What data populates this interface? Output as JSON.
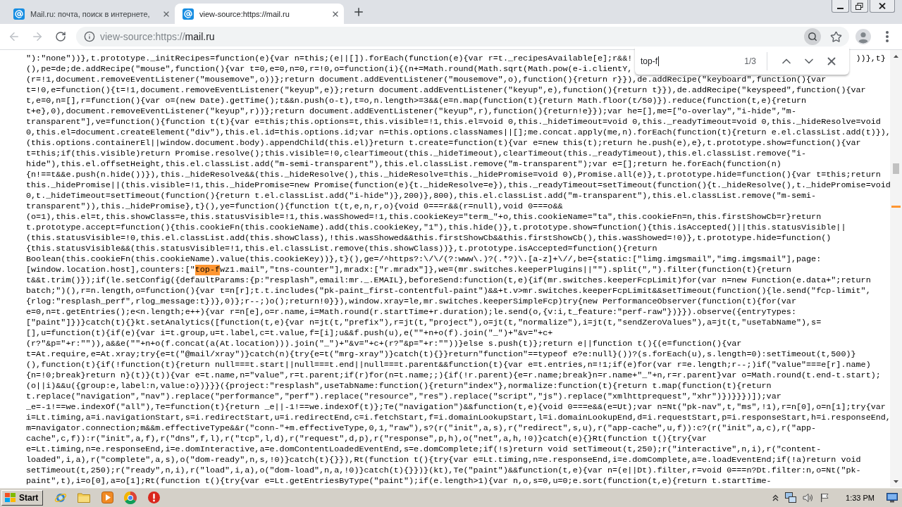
{
  "tabs": [
    {
      "title": "Mail.ru: почта, поиск в интернете,",
      "selected": false
    },
    {
      "title": "view-source:https://mail.ru",
      "selected": true
    }
  ],
  "toolbar": {
    "back_disabled": true,
    "forward_disabled": true,
    "address": {
      "prefix": "view-source:https://",
      "host": "mail.ru"
    }
  },
  "find_bar": {
    "query": "top-f",
    "count": "1/3"
  },
  "source": {
    "lines": [
      {
        "parts": [
          {
            "text": "\"):\"none\"))},t.prototype._initRecipes=function(e){var n=this;(e||[]).forEach(function(e){var r=t._recipesAvailable[e];r&&!",
            "highlighted": false
          }
        ],
        "tail": "))},t}"
      },
      {
        "parts": [
          {
            "text": "(),pe=de;de.addRecipe(\"mouse\",function(){var t=0,e=0,n=0,r=!0,o=function(i){(n+=Math.round(Math.sqrt(Math.pow(e-i.clientY,",
            "highlighted": false
          }
        ]
      },
      {
        "parts": [
          {
            "text": "(r=!1,document.removeEventListener(\"mousemove\",o))};return document.addEventListener(\"mousemove\",o),function(){return r}}),de.addRecipe(\"keyboard\",function(){var",
            "highlighted": false
          }
        ]
      },
      {
        "parts": [
          {
            "text": "t=!0,e=function(){t=!1,document.removeEventListener(\"keyup\",e)};return document.addEventListener(\"keyup\",e),function(){return t}}),de.addRecipe(\"keyspeed\",function(){var",
            "highlighted": false
          }
        ]
      },
      {
        "parts": [
          {
            "text": "t,e=0,n=[],r=function(){var o=(new Date).getTime();t&&n.push(o-t),t=o,n.length>=3&&(e=n.map(function(t){return Math.floor(t/50)}).reduce(function(t,e){return",
            "highlighted": false
          }
        ]
      },
      {
        "parts": [
          {
            "text": "t+e},0),document.removeEventListener(\"keyup\",r))};return document.addEventListener(\"keyup\",r),function(){return!e}});var he=[],me=[\"o-overlay\",\"i-hide\",\"m-",
            "highlighted": false
          }
        ]
      },
      {
        "parts": [
          {
            "text": "transparent\"],ve=function(){function t(t){var e=this;this.options=t,this.visible=!1,this.el=void 0,this._hideTimeout=void 0,this._readyTimeout=void 0,this._hideResolve=void",
            "highlighted": false
          }
        ]
      },
      {
        "parts": [
          {
            "text": "0,this.el=document.createElement(\"div\"),this.el.id=this.options.id;var n=this.options.classNames||[];me.concat.apply(me,n).forEach(function(t){return e.el.classList.add(t)}),",
            "highlighted": false
          }
        ]
      },
      {
        "parts": [
          {
            "text": "(this.options.containerEl||window.document.body).appendChild(this.el)}return t.create=function(t){var e=new this(t);return he.push(e),e},t.prototype.show=function(){var",
            "highlighted": false
          }
        ]
      },
      {
        "parts": [
          {
            "text": "t=this;if(this.visible)return Promise.resolve();this.visible=!0,clearTimeout(this._hideTimeout),clearTimeout(this._readyTimeout),this.el.classList.remove(\"i-",
            "highlighted": false
          }
        ]
      },
      {
        "parts": [
          {
            "text": "hide\"),this.el.offsetHeight,this.el.classList.add(\"m-semi-transparent\"),this.el.classList.remove(\"m-transparent\");var e=[];return he.forEach(function(n)",
            "highlighted": false
          }
        ]
      },
      {
        "parts": [
          {
            "text": "{n!==t&&e.push(n.hide())}),this._hideResolve&&(this._hideResolve(),this._hideResolve=this._hidePromise=void 0),Promise.all(e)},t.prototype.hide=function(){var t=this;return",
            "highlighted": false
          }
        ]
      },
      {
        "parts": [
          {
            "text": "this._hidePromise||(this.visible=!1,this._hidePromise=new Promise(function(e){t._hideResolve=e}),this._readyTimeout=setTimeout(function(){t._hideResolve(),t._hidePromise=void",
            "highlighted": false
          }
        ]
      },
      {
        "parts": [
          {
            "text": "0,t._hideTimeout=setTimeout(function(){return t.el.classList.add(\"i-hide\")},200)},800),this.el.classList.add(\"m-transparent\"),this.el.classList.remove(\"m-semi-",
            "highlighted": false
          }
        ]
      },
      {
        "parts": [
          {
            "text": "transparent\")),this._hidePromise},t}(),ye=function(){function t(t,e,n,r,o){void 0===r&&(r=null),void 0===o&&",
            "highlighted": false
          }
        ]
      },
      {
        "parts": [
          {
            "text": "(o=1),this.el=t,this.showClass=e,this.statusVisible=!1,this.wasShowed=!1,this.cookieKey=\"term_\"+o,this.cookieName=\"ta\",this.cookieFn=n,this.firstShowCb=r}return",
            "highlighted": false
          }
        ]
      },
      {
        "parts": [
          {
            "text": "t.prototype.accept=function(){this.cookieFn(this.cookieName).add(this.cookieKey,\"1\"),this.hide()},t.prototype.show=function(){this.isAccepted()||this.statusVisible||",
            "highlighted": false
          }
        ]
      },
      {
        "parts": [
          {
            "text": "(this.statusVisible=!0,this.el.classList.add(this.showClass),!this.wasShowed&&this.firstShowCb&&this.firstShowCb(),this.wasShowed=!0)},t.prototype.hide=function()",
            "highlighted": false
          }
        ]
      },
      {
        "parts": [
          {
            "text": "{this.statusVisible&&(this.statusVisible=!1,this.el.classList.remove(this.showClass))},t.prototype.isAccepted=function(){return",
            "highlighted": false
          }
        ]
      },
      {
        "parts": [
          {
            "text": "Boolean(this.cookieFn(this.cookieName).value(this.cookieKey))},t}(),ge=/^https?:\\/\\/(?:www\\.)?(.*?)\\.[a-z]+\\//,be={static:[\"limg.imgsmail\",\"img.imgsmail\"],page:",
            "highlighted": false
          }
        ]
      },
      {
        "parts": [
          {
            "text": "[window.location.host],counters:[\"",
            "highlighted": false
          },
          {
            "text": "top-f",
            "highlighted": true
          },
          {
            "text": "wz1.mail\",\"tns-counter\"],mradx:[\"r.mradx\"]},we=(mr.switches.keeperPlugins||\"\").split(\",\").filter(function(t){return",
            "highlighted": false
          }
        ]
      },
      {
        "parts": [
          {
            "text": "t&&t.trim()});if(le.setConfig({defaultParams:{p:\"resplash\",email:mr._.EMAIL},beforeSend:function(t,e){if(mr.switches.keeperFcpLimit)for(var n=new Function(e.data+\";return",
            "highlighted": false
          }
        ]
      },
      {
        "parts": [
          {
            "text": "batch;\")(),r=n.length,o=function(){var t=n[r];t.t.includes(\"pk-paint_first-contentful-paint\")&&+t.v>mr.switches.keeperFcpLimit&&setTimeout(function(){le.send(\"fcp-limit\",",
            "highlighted": false
          }
        ]
      },
      {
        "parts": [
          {
            "text": "{rlog:\"resplash_perf\",rlog_message:t})},0)};r--;)o();return!0}}),window.xray=le,mr.switches.keeperSimpleFcp)try{new PerformanceObserver(function(t){for(var",
            "highlighted": false
          }
        ]
      },
      {
        "parts": [
          {
            "text": "e=0,n=t.getEntries();e<n.length;e++){var r=n[e],o=r.name,i=Math.round(r.startTime+r.duration);le.send(o,{v:i,t_feature:\"perf-raw\"})}}).observe({entryTypes:",
            "highlighted": false
          }
        ]
      },
      {
        "parts": [
          {
            "text": "[\"paint\"]})}catch(t){}kt.setAnalytics([function(t,e){var n=jt(t,\"prefix\"),r=jt(t,\"project\"),o=jt(t,\"normalize\"),i=jt(t,\"sendZeroValues\"),a=jt(t,\"useTabName\"),s=",
            "highlighted": false
          }
        ]
      },
      {
        "parts": [
          {
            "text": "[],u=function(t){if(e){var i=t.group,u=t.label,c=t.value,f=[i];u&&f.push(u),e(\"\"+n+o(f).join(\"_\")+\"&v=\"+c+",
            "highlighted": false
          }
        ]
      },
      {
        "parts": [
          {
            "text": "(r?\"&p=\"+r:\"\")),a&&e(\"\"+n+o(f.concat(a(At.location))).join(\"_\")+\"&v=\"+c+(r?\"&p=\"+r:\"\"))}else s.push(t)};return e||function t(){(e=function(){var",
            "highlighted": false
          }
        ]
      },
      {
        "parts": [
          {
            "text": "t=At.require,e=At.xray;try{e=t(\"@mail/xray\")}catch(n){try{e=t(\"mrg-xray\")}catch(t){}}return\"function\"==typeof e?e:null}())?(s.forEach(u),s.length=0):setTimeout(t,500)}",
            "highlighted": false
          }
        ]
      },
      {
        "parts": [
          {
            "text": "(),function(t){if(!function(t){return null===t.start||null===t.end||null===t.parent&&function(t){var e=t.entries,n=!1;if(e)for(var r=e.length;r--;)if(\"value\"===e[r].name)",
            "highlighted": false
          }
        ]
      },
      {
        "parts": [
          {
            "text": "{n=!0;break}return n}(t)}(t)){var e=t.name,n=\"value\",r=t.parent;if(r)for(n=t.name;;){if(!r.parent){e=r.name;break}n=r.name+\"_\"+n,r=r.parent}var o=Math.round(t.end-t.start);",
            "highlighted": false
          }
        ]
      },
      {
        "parts": [
          {
            "text": "(o||i)&&u({group:e,label:n,value:o})}}}({project:\"resplash\",useTabName:function(){return\"index\"},normalize:function(t){return t.map(function(t){return",
            "highlighted": false
          }
        ]
      },
      {
        "parts": [
          {
            "text": "t.replace(\"navigation\",\"nav\").replace(\"performance\",\"perf\").replace(\"resource\",\"res\").replace(\"script\",\"js\").replace(\"xmlhttprequest\",\"xhr\")})}}})]);var",
            "highlighted": false
          }
        ]
      },
      {
        "parts": [
          {
            "text": "_e=-1!==we.indexOf(\"all\"),Te=function(t){return _e||-1!==we.indexOf(t)};Te(\"navigation\")&&function(t,e){void 0===e&&(e=Ut);var n=Nt(\"pk-nav\",t,\"ms\",!1),r=n[0],o=n[1];try{var",
            "highlighted": false
          }
        ]
      },
      {
        "parts": [
          {
            "text": "i=Lt.timing,a=i.navigationStart,s=i.redirectStart,u=i.redirectEnd,c=i.fetchStart,f=i.domainLookupStart,l=i.domainLookupEnd,d=i.requestStart,p=i.responseStart,h=i.responseEnd,",
            "highlighted": false
          }
        ]
      },
      {
        "parts": [
          {
            "text": "m=navigator.connection;m&&m.effectiveType&&r(\"conn-\"+m.effectiveType,0,1,\"raw\"),s?(r(\"init\",a,s),r(\"redirect\",s,u),r(\"app-cache\",u,f)):c?(r(\"init\",a,c),r(\"app-",
            "highlighted": false
          }
        ]
      },
      {
        "parts": [
          {
            "text": "cache\",c,f)):r(\"init\",a,f),r(\"dns\",f,l),r(\"tcp\",l,d),r(\"request\",d,p),r(\"response\",p,h),o(\"net\",a,h,!0)}catch(e){}Rt(function t(){try{var",
            "highlighted": false
          }
        ]
      },
      {
        "parts": [
          {
            "text": "e=Lt.timing,n=e.responseEnd,i=e.domInteractive,a=e.domContentLoadedEventEnd,s=e.domComplete;if(!s)return void setTimeout(t,250);r(\"interactive\",n,i),r(\"content-",
            "highlighted": false
          }
        ]
      },
      {
        "parts": [
          {
            "text": "loaded\",i,a),r(\"complete\",a,s),o(\"dom-ready\",n,s,!0)}catch(t){}}),Rt(function t(){try{var e=Lt.timing,n=e.responseEnd,i=e.domComplete,a=e.loadEventEnd;if(!a)return void",
            "highlighted": false
          }
        ]
      },
      {
        "parts": [
          {
            "text": "setTimeout(t,250);r(\"ready\",n,i),r(\"load\",i,a),o(\"dom-load\",n,a,!0)}catch(t){}})}(kt),Te(\"paint\")&&function(t,e){var n=(e||Dt).filter,r=void 0===n?Dt.filter:n,o=Nt(\"pk-",
            "highlighted": false
          }
        ]
      },
      {
        "parts": [
          {
            "text": "paint\",t),i=o[0],a=o[1];Rt(function t(){try{var e=Lt.getEntriesByType(\"paint\");if(e.length>1){var n,o,s=0,u=0;e.sort(function(t,e){return t.startTime-",
            "highlighted": false
          }
        ]
      }
    ]
  },
  "taskbar": {
    "start": "Start",
    "clock": "1:33 PM"
  }
}
